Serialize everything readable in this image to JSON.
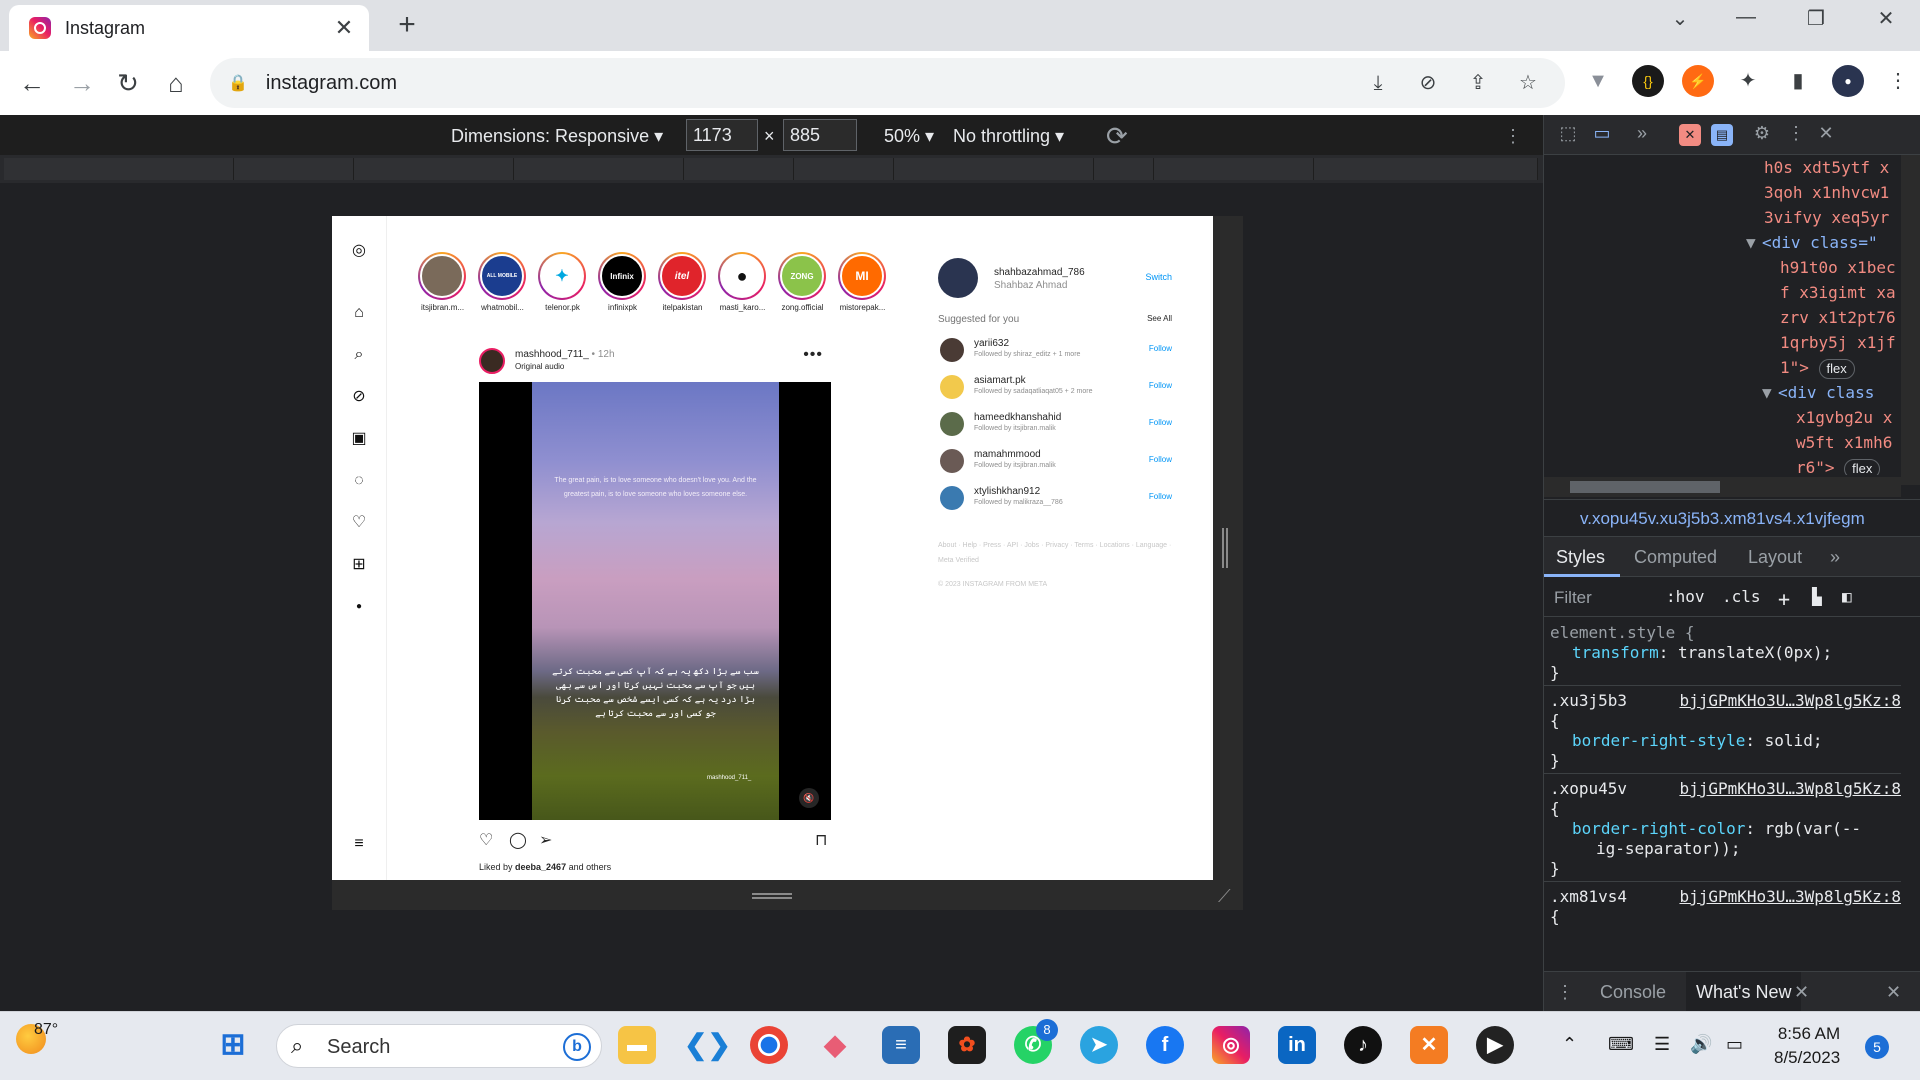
{
  "browser": {
    "tab_title": "Instagram",
    "tab_close": "✕",
    "new_tab": "+",
    "url": "instagram.com",
    "window_controls": {
      "minimize": "—",
      "restore": "❐",
      "close": "✕",
      "tabs_menu": "⌄"
    }
  },
  "device_toolbar": {
    "dimensions_label": "Dimensions: Responsive ▾",
    "width": "1173",
    "times": "×",
    "height": "885",
    "zoom": "50% ▾",
    "throttling": "No throttling ▾"
  },
  "instagram": {
    "stories": [
      {
        "name": "itsjibran.m...",
        "color": "#7a6a5a"
      },
      {
        "name": "whatmobil...",
        "color": "#1b3d8f"
      },
      {
        "name": "telenor.pk",
        "color": "#ffffff"
      },
      {
        "name": "infinixpk",
        "color": "#000000"
      },
      {
        "name": "itelpakistan",
        "color": "#e0242b"
      },
      {
        "name": "masti_karo...",
        "color": "#ffffff"
      },
      {
        "name": "zong.official",
        "color": "#8bc34a"
      },
      {
        "name": "mistorepak...",
        "color": "#ff6a00"
      }
    ],
    "story_logos": [
      "",
      "ALL MOBILE",
      "",
      "Infinix",
      "itel",
      "",
      "ZONG",
      "MI"
    ],
    "post": {
      "username": "mashhood_711_",
      "time": " • 12h",
      "audio": "Original audio",
      "more": "•••",
      "quote_en": "The great pain, is to love someone who doesn't love you. And the greatest pain, is to love someone who loves someone else.",
      "quote_ur": "سب سے بڑا دکھ یہ ہے کہ آپ کسی سے محبت کرتے ہیں جو آپ سے محبت نہیں کرتا اور اس سے بھی بڑا درد یہ ہے کہ کسی ایسے شخص سے محبت کرنا جو کسی اور سے محبت کرتا ہے",
      "watermark": "mashhood_711_",
      "liked_by_prefix": "Liked by ",
      "liked_by_user": "deeba_2467",
      "liked_by_suffix": " and others"
    },
    "profile": {
      "username": "shahbazahmad_786",
      "name": "Shahbaz Ahmad",
      "switch": "Switch"
    },
    "suggested_title": "Suggested for you",
    "see_all": "See All",
    "suggestions": [
      {
        "username": "yarii632",
        "sub": "Followed by shiraz_editz + 1 more",
        "action": "Follow",
        "color": "#4a3b35"
      },
      {
        "username": "asiamart.pk",
        "sub": "Followed by sadaqatliaqat05 + 2 more",
        "action": "Follow",
        "color": "#f2c94c"
      },
      {
        "username": "hameedkhanshahid",
        "sub": "Followed by itsjibran.malik",
        "action": "Follow",
        "color": "#5b6b4a"
      },
      {
        "username": "mamahmmood",
        "sub": "Followed by itsjibran.malik",
        "action": "Follow",
        "color": "#6a5a55"
      },
      {
        "username": "xtylishkhan912",
        "sub": "Followed by malikraza__786",
        "action": "Follow",
        "color": "#3a7ab0"
      }
    ],
    "footer_links": "About · Help · Press · API · Jobs · Privacy · Terms · Locations · Language · Meta Verified",
    "copyright": "© 2023 INSTAGRAM FROM META"
  },
  "devtools": {
    "elements_lines": [
      "h0s xdt5ytf x",
      "3qoh x1nhvcw1",
      "3vifvy xeq5yr",
      "<div class=\"",
      "h91t0o x1bec",
      "f x3igimt xa",
      "zrv x1t2pt76",
      "1qrby5j x1jf",
      "1\">",
      "<div class",
      "x1gvbg2u x",
      "w5ft x1mh6",
      "r6\">"
    ],
    "flex_pill": "flex",
    "breadcrumb": "v.xopu45v.xu3j5b3.xm81vs4.x1vjfegm",
    "tabs": {
      "styles": "Styles",
      "computed": "Computed",
      "layout": "Layout",
      "more": "»"
    },
    "filter_placeholder": "Filter",
    "hov": ":hov",
    "cls": ".cls",
    "rules": [
      {
        "selector": "element.style {",
        "prop": "transform",
        "value": "translateX(0px);"
      },
      {
        "selector": ".xu3j5b3",
        "source": "bjjGPmKHo3U…3Wp8lg5Kz:8",
        "prop": "border-right-style",
        "value": "solid;"
      },
      {
        "selector": ".xopu45v",
        "source": "bjjGPmKHo3U…3Wp8lg5Kz:8",
        "prop": "border-right-color",
        "value": "rgb(var(--",
        "value2": "ig-separator));"
      },
      {
        "selector": ".xm81vs4",
        "source": "bjjGPmKHo3U…3Wp8lg5Kz:8"
      }
    ],
    "drawer": {
      "console": "Console",
      "whats_new": "What's New",
      "close": "✕"
    }
  },
  "taskbar": {
    "temperature": "87°",
    "search": "Search",
    "messages_badge": "8",
    "time": "8:56 AM",
    "date": "8/5/2023",
    "notifications": "5"
  }
}
